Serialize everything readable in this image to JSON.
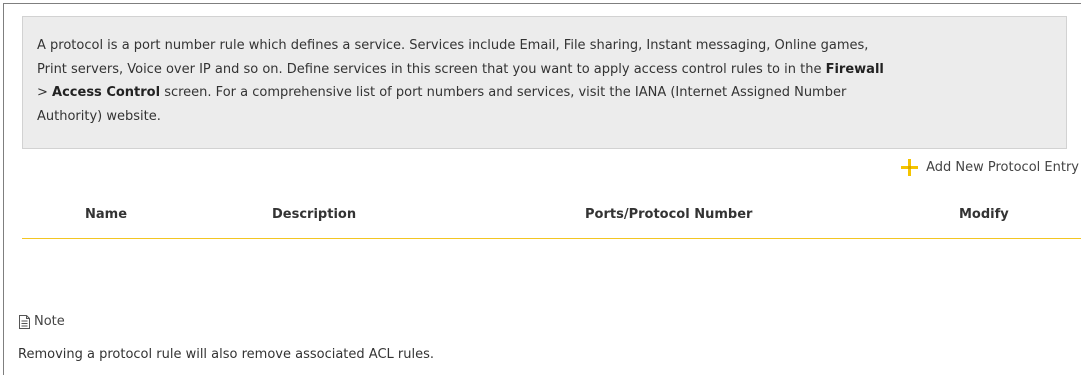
{
  "intro": {
    "line1": "A protocol is a port number rule which defines a service. Services include Email, File sharing, Instant messaging, Online games,",
    "line2_prefix": "Print servers, Voice over IP and so on. Define services in this screen that you want to apply access control rules to in the ",
    "firewall_bold": "Firewall",
    "line3_prefix": "> ",
    "access_control_bold": "Access Control",
    "line3_suffix": " screen. For a comprehensive list of port numbers and services, visit the IANA (Internet Assigned Number",
    "line4": "Authority) website."
  },
  "toolbar": {
    "add_label": "Add New Protocol Entry",
    "add_icon": "plus-icon",
    "add_icon_color": "#f5c400"
  },
  "table": {
    "columns": [
      "Name",
      "Description",
      "Ports/Protocol Number",
      "Modify"
    ],
    "rows": []
  },
  "note": {
    "icon": "note-icon",
    "label": "Note",
    "text": "Removing a protocol rule will also remove associated ACL rules."
  }
}
